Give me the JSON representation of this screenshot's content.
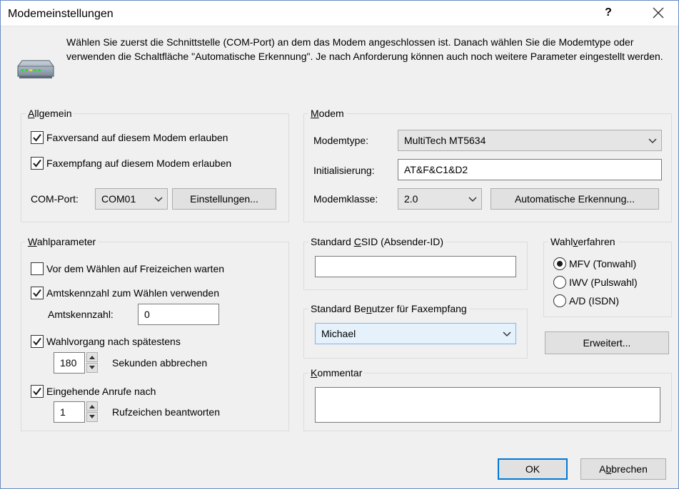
{
  "window": {
    "title": "Modemeinstellungen",
    "help": "?"
  },
  "intro": {
    "text": "Wählen Sie zuerst die Schnittstelle (COM-Port) an dem das Modem angeschlossen ist. Danach wählen Sie die Modemtype oder verwenden die Schaltfläche \"Automatische Erkennung\". Je nach Anforderung können auch noch weitere Parameter eingestellt werden."
  },
  "allgemein": {
    "title": "Allgemein",
    "faxversand_label": "Faxversand auf diesem Modem erlauben",
    "faxversand_checked": true,
    "faxempfang_label": "Faxempfang auf diesem Modem erlauben",
    "faxempfang_checked": true,
    "comport_label": "COM-Port:",
    "comport_value": "COM01",
    "einstellungen_label": "Einstellungen..."
  },
  "modem": {
    "title": "Modem",
    "modemtype_label": "Modemtype:",
    "modemtype_value": "MultiTech MT5634",
    "init_label": "Initialisierung:",
    "init_value": "AT&F&C1&D2",
    "klasse_label": "Modemklasse:",
    "klasse_value": "2.0",
    "auto_label": "Automatische Erkennung..."
  },
  "wahlparameter": {
    "title": "Wahlparameter",
    "freizeichen_label": "Vor dem Wählen auf Freizeichen warten",
    "freizeichen_checked": false,
    "amtskennzahl_cb_label": "Amtskennzahl zum Wählen verwenden",
    "amtskennzahl_cb_checked": true,
    "amtskennzahl_label": "Amtskennzahl:",
    "amtskennzahl_value": "0",
    "wahlvorgang_label": "Wahlvorgang nach spätestens",
    "wahlvorgang_checked": true,
    "sekunden_value": "180",
    "sekunden_label": "Sekunden abbrechen",
    "eingehende_label": "Eingehende Anrufe nach",
    "eingehende_checked": true,
    "rufzeichen_value": "1",
    "rufzeichen_label": "Rufzeichen beantworten"
  },
  "csid": {
    "title": "Standard CSID (Absender-ID)",
    "value": ""
  },
  "benutzer": {
    "title": "Standard Benutzer für Faxempfang",
    "value": "Michael"
  },
  "wahlverfahren": {
    "title": "Wahlverfahren",
    "options": [
      "MFV (Tonwahl)",
      "IWV (Pulswahl)",
      "A/D (ISDN)"
    ],
    "selected": "MFV (Tonwahl)"
  },
  "erweitert_label": "Erweitert...",
  "kommentar": {
    "title": "Kommentar",
    "value": ""
  },
  "buttons": {
    "ok": "OK",
    "abbrechen": "Abbrechen"
  },
  "colors": {
    "accent": "#0078d7",
    "dialog_bg": "#f0f0f0"
  }
}
